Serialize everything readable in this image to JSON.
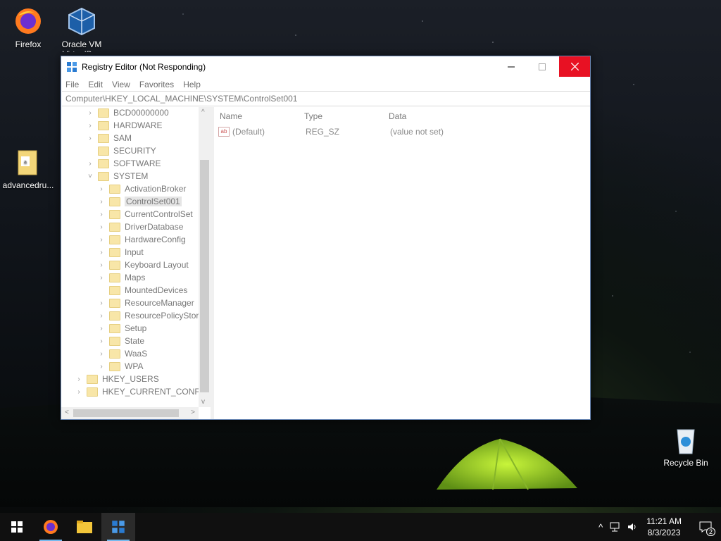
{
  "desktop": {
    "icons": [
      {
        "label": "Firefox"
      },
      {
        "label": "Oracle VM VirtualBox"
      },
      {
        "label": "advancedru..."
      },
      {
        "label": "Recycle Bin"
      }
    ]
  },
  "window": {
    "title": "Registry Editor (Not Responding)",
    "menu": [
      "File",
      "Edit",
      "View",
      "Favorites",
      "Help"
    ],
    "address": "Computer\\HKEY_LOCAL_MACHINE\\SYSTEM\\ControlSet001",
    "tree": [
      {
        "label": "BCD00000000",
        "level": 1,
        "expander": ">"
      },
      {
        "label": "HARDWARE",
        "level": 1,
        "expander": ">"
      },
      {
        "label": "SAM",
        "level": 1,
        "expander": ">"
      },
      {
        "label": "SECURITY",
        "level": 1,
        "expander": ""
      },
      {
        "label": "SOFTWARE",
        "level": 1,
        "expander": ">"
      },
      {
        "label": "SYSTEM",
        "level": 1,
        "expander": "v"
      },
      {
        "label": "ActivationBroker",
        "level": 2,
        "expander": ">"
      },
      {
        "label": "ControlSet001",
        "level": 2,
        "expander": ">",
        "selected": true
      },
      {
        "label": "CurrentControlSet",
        "level": 2,
        "expander": ">"
      },
      {
        "label": "DriverDatabase",
        "level": 2,
        "expander": ">"
      },
      {
        "label": "HardwareConfig",
        "level": 2,
        "expander": ">"
      },
      {
        "label": "Input",
        "level": 2,
        "expander": ">"
      },
      {
        "label": "Keyboard Layout",
        "level": 2,
        "expander": ">"
      },
      {
        "label": "Maps",
        "level": 2,
        "expander": ">"
      },
      {
        "label": "MountedDevices",
        "level": 2,
        "expander": ""
      },
      {
        "label": "ResourceManager",
        "level": 2,
        "expander": ">"
      },
      {
        "label": "ResourcePolicyStore",
        "level": 2,
        "expander": ">"
      },
      {
        "label": "Setup",
        "level": 2,
        "expander": ">"
      },
      {
        "label": "State",
        "level": 2,
        "expander": ">"
      },
      {
        "label": "WaaS",
        "level": 2,
        "expander": ">"
      },
      {
        "label": "WPA",
        "level": 2,
        "expander": ">"
      },
      {
        "label": "HKEY_USERS",
        "level": 0,
        "expander": ">"
      },
      {
        "label": "HKEY_CURRENT_CONFIG",
        "level": 0,
        "expander": ">"
      }
    ],
    "list": {
      "headers": {
        "name": "Name",
        "type": "Type",
        "data": "Data"
      },
      "rows": [
        {
          "name": "(Default)",
          "type": "REG_SZ",
          "data": "(value not set)"
        }
      ]
    }
  },
  "taskbar": {
    "time": "11:21 AM",
    "date": "8/3/2023",
    "notification_count": "2"
  }
}
